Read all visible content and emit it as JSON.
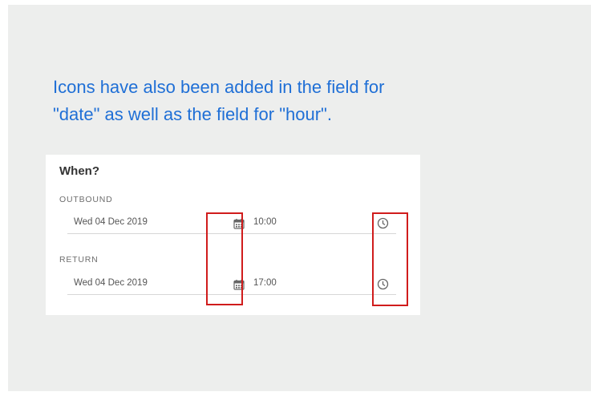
{
  "caption": {
    "line1": "Icons have also been added in the field for",
    "line2": "\"date\" as well as the field for \"hour\"."
  },
  "form": {
    "title": "When?",
    "outbound": {
      "label": "OUTBOUND",
      "date": "Wed 04 Dec 2019",
      "time": "10:00"
    },
    "return": {
      "label": "RETURN",
      "date": "Wed 04 Dec 2019",
      "time": "17:00"
    }
  },
  "icons": {
    "date": "calendar-icon",
    "hour": "clock-icon"
  },
  "colors": {
    "caption": "#1f6fd6",
    "highlight": "#d01c1c",
    "slide_background": "#edeeed"
  }
}
